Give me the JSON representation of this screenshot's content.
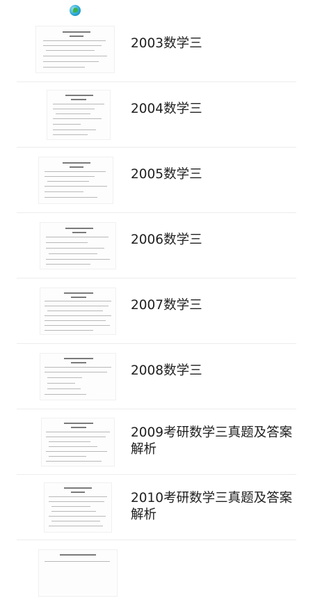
{
  "status_bar": {
    "app_icon": "app-globe-icon"
  },
  "list": {
    "items": [
      {
        "title": "2003数学三",
        "thumbnail": "document-page-thumbnail"
      },
      {
        "title": "2004数学三",
        "thumbnail": "document-page-thumbnail"
      },
      {
        "title": "2005数学三",
        "thumbnail": "document-page-thumbnail"
      },
      {
        "title": "2006数学三",
        "thumbnail": "document-page-thumbnail"
      },
      {
        "title": "2007数学三",
        "thumbnail": "document-page-thumbnail"
      },
      {
        "title": "2008数学三",
        "thumbnail": "document-page-thumbnail"
      },
      {
        "title": "2009考研数学三真题及答案解析",
        "thumbnail": "document-page-thumbnail"
      },
      {
        "title": "2010考研数学三真题及答案解析",
        "thumbnail": "document-page-thumbnail"
      },
      {
        "title": "",
        "thumbnail": "document-page-thumbnail"
      }
    ]
  },
  "colors": {
    "background": "#ffffff",
    "text": "#202020",
    "divider": "#ececec"
  }
}
